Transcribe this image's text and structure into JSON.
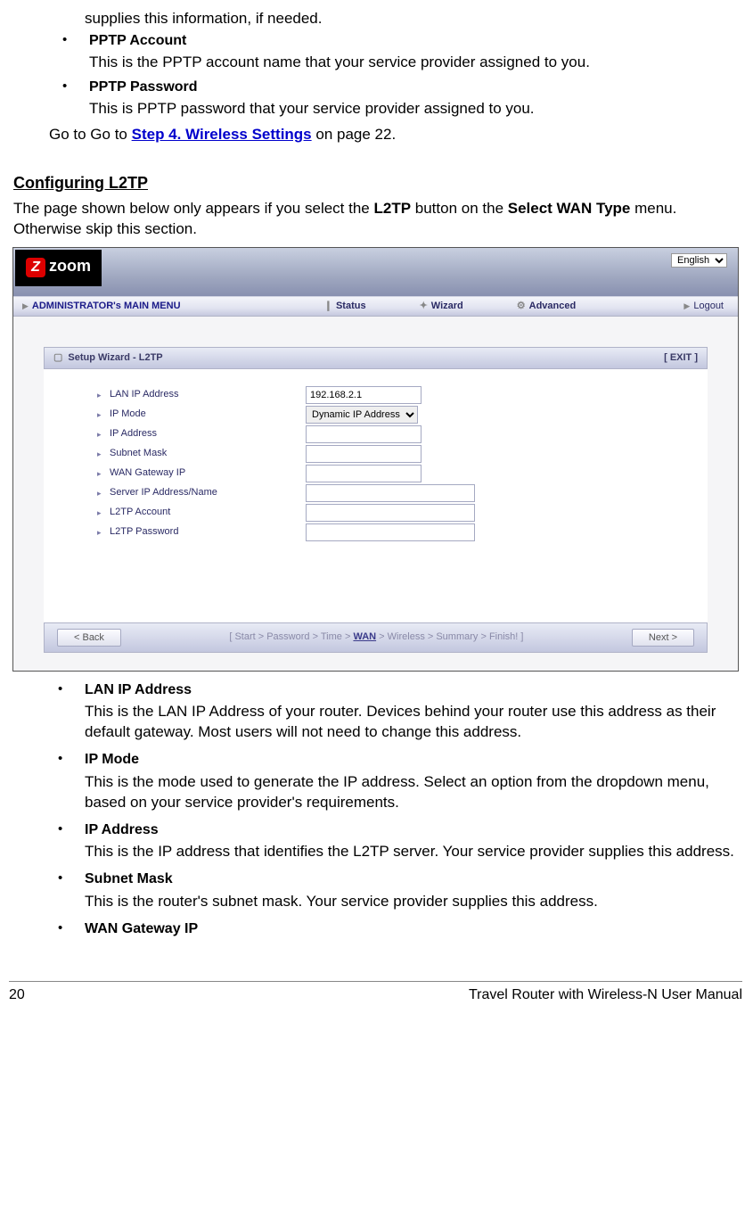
{
  "topFragment": {
    "trail": "supplies this information, if needed.",
    "items": [
      {
        "title": "PPTP Account",
        "desc": "This is the PPTP account name that your service provider assigned to you."
      },
      {
        "title": "PPTP Password",
        "desc": "This is PPTP password that your service provider assigned to you."
      }
    ],
    "gotoPre": "Go to Go to ",
    "gotoLink": "Step 4. Wireless Settings",
    "gotoPost": " on page 22."
  },
  "section": {
    "heading": "Configuring L2TP",
    "intro1": "The page shown below only appears if you select the ",
    "introBold1": "L2TP",
    "intro2": " button on the ",
    "introBold2": "Select WAN Type",
    "intro3": " menu. Otherwise skip this section."
  },
  "shot": {
    "logoText": "zoom",
    "language": "English",
    "navTitle": "ADMINISTRATOR's MAIN MENU",
    "tabs": [
      "Status",
      "Wizard",
      "Advanced"
    ],
    "logout": "Logout",
    "wizTitle": "Setup Wizard - L2TP",
    "exit": "[ EXIT ]",
    "fields": {
      "lanip": {
        "label": "LAN IP Address",
        "value": "192.168.2.1"
      },
      "ipmode": {
        "label": "IP Mode",
        "value": "Dynamic IP Address"
      },
      "ipaddr": {
        "label": "IP Address",
        "value": ""
      },
      "subnet": {
        "label": "Subnet Mask",
        "value": ""
      },
      "wangw": {
        "label": "WAN Gateway IP",
        "value": ""
      },
      "server": {
        "label": "Server IP Address/Name",
        "value": ""
      },
      "l2acc": {
        "label": "L2TP Account",
        "value": ""
      },
      "l2pwd": {
        "label": "L2TP Password",
        "value": ""
      }
    },
    "back": "< Back",
    "crumb": {
      "pre": "[ Start > Password > Time > ",
      "cur": "WAN",
      "post": " > Wireless > Summary > Finish! ]"
    },
    "next": "Next >"
  },
  "bullets": [
    {
      "title": "LAN IP Address",
      "desc": "This is the LAN IP Address of your router. Devices behind your router use this address as their default gateway. Most users will not need to change this address."
    },
    {
      "title": "IP Mode",
      "desc": "This is the mode used to generate the IP address. Select an option from the dropdown menu, based on your service provider's requirements."
    },
    {
      "title": "IP Address",
      "desc": "This is the IP address that identifies the L2TP server. Your service provider supplies this address."
    },
    {
      "title": "Subnet Mask",
      "desc": "This is the router's subnet mask. Your service provider supplies this address."
    },
    {
      "title": "WAN Gateway IP",
      "desc": ""
    }
  ],
  "footer": {
    "pageNum": "20",
    "docTitle": "Travel Router with Wireless-N User Manual"
  }
}
